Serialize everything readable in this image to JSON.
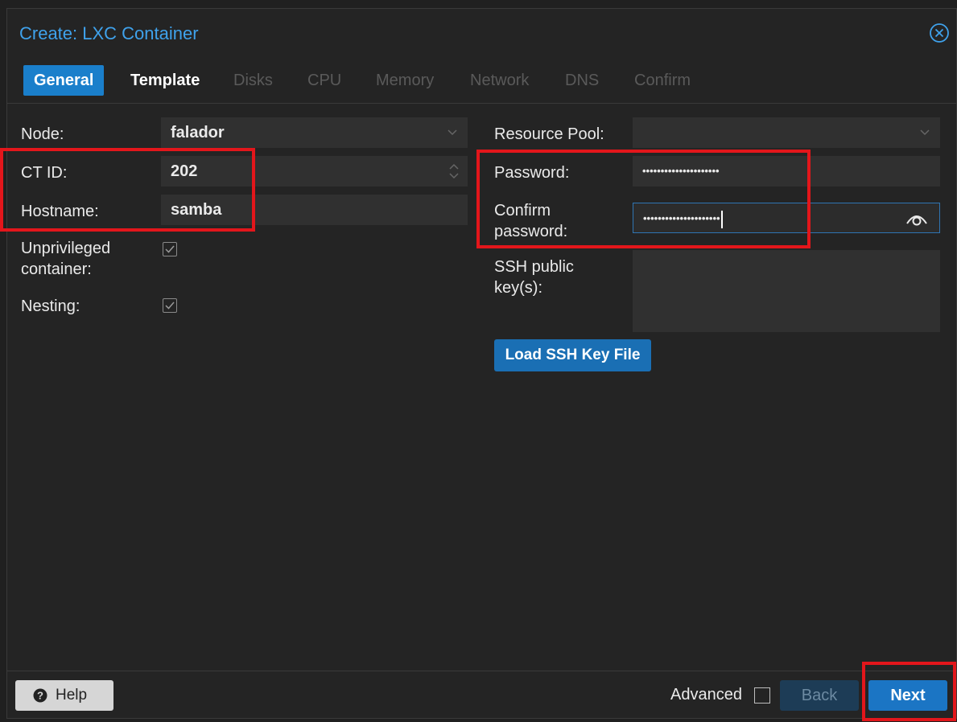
{
  "dialog": {
    "title": "Create: LXC Container"
  },
  "tabs": [
    {
      "label": "General",
      "state": "active"
    },
    {
      "label": "Template",
      "state": "enabled"
    },
    {
      "label": "Disks",
      "state": "disabled"
    },
    {
      "label": "CPU",
      "state": "disabled"
    },
    {
      "label": "Memory",
      "state": "disabled"
    },
    {
      "label": "Network",
      "state": "disabled"
    },
    {
      "label": "DNS",
      "state": "disabled"
    },
    {
      "label": "Confirm",
      "state": "disabled"
    }
  ],
  "left_form": {
    "node_label": "Node:",
    "node_value": "falador",
    "ctid_label": "CT ID:",
    "ctid_value": "202",
    "hostname_label": "Hostname:",
    "hostname_value": "samba",
    "unprivileged_label_line1": "Unprivileged",
    "unprivileged_label_line2": "container:",
    "unprivileged_checked": true,
    "nesting_label": "Nesting:",
    "nesting_checked": true
  },
  "right_form": {
    "pool_label": "Resource Pool:",
    "pool_value": "",
    "password_label": "Password:",
    "password_value": "•••••••••••••••••••••",
    "confirm_label_line1": "Confirm",
    "confirm_label_line2": "password:",
    "confirm_value": "•••••••••••••••••••••",
    "ssh_label_line1": "SSH public",
    "ssh_label_line2": "key(s):",
    "ssh_value": "",
    "load_ssh_label": "Load SSH Key File"
  },
  "footer": {
    "help_label": "Help",
    "advanced_label": "Advanced",
    "advanced_checked": false,
    "back_label": "Back",
    "next_label": "Next"
  },
  "colors": {
    "accent": "#1a7fcb",
    "title": "#3fa2ec",
    "highlight": "#e3161b",
    "background": "#242424",
    "field": "#303030"
  },
  "icons": [
    "close-circle-icon",
    "chevron-down-icon",
    "spinner-updown-icon",
    "checkmark-icon",
    "eye-icon",
    "question-circle-icon"
  ]
}
